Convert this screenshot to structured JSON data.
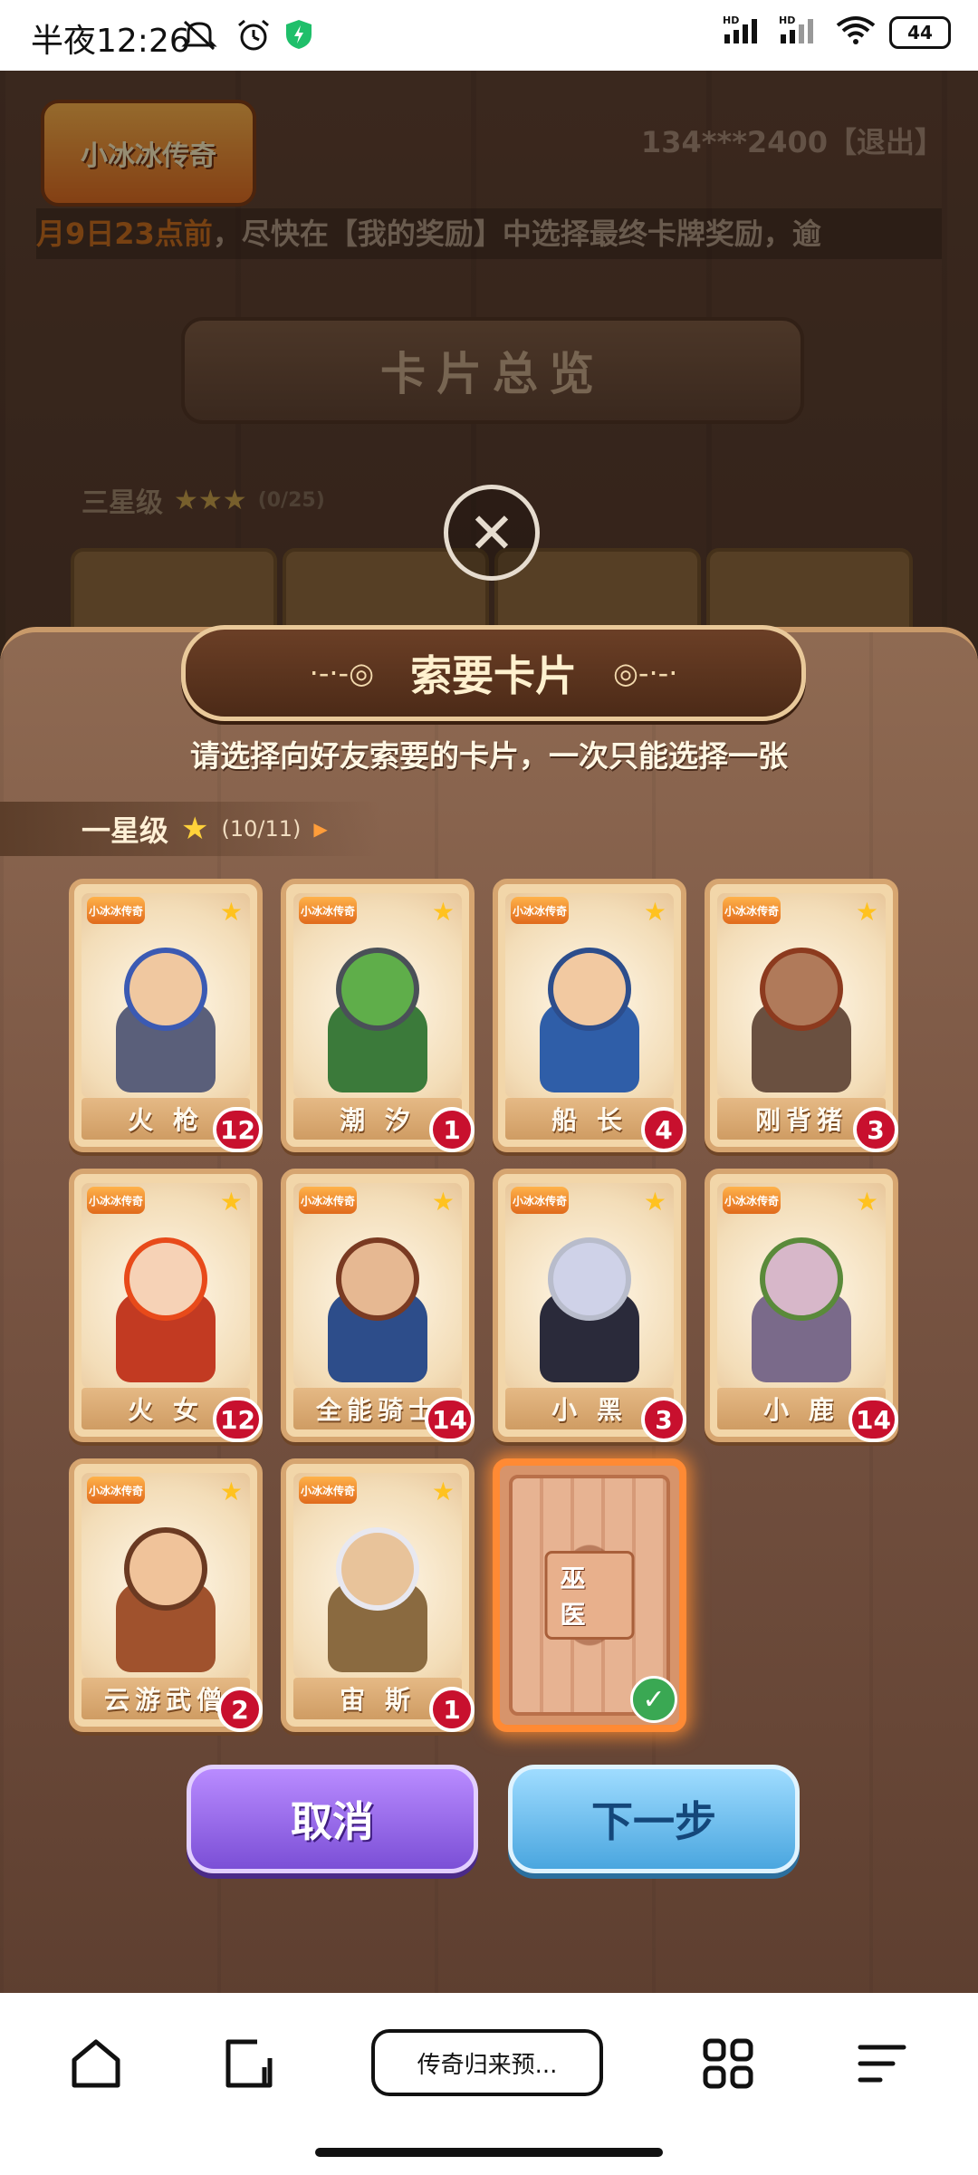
{
  "status_bar": {
    "time": "半夜12:26",
    "network": "HD",
    "wifi_label": "6",
    "battery": "44"
  },
  "game": {
    "logo_text": "小冰冰传奇",
    "account": "134***2400【退出】",
    "marquee_highlight": "月9日23点前",
    "marquee_text": "，尽快在【我的奖励】中选择最终卡牌奖励，逾",
    "banner_title": "卡片总览",
    "section_three_star": "三星级",
    "section_three_star_count": "(0/25)"
  },
  "modal": {
    "title": "索要卡片",
    "subtitle": "请选择向好友索要的卡片，一次只能选择一张",
    "tier_name": "一星级",
    "tier_count": "(10/11)",
    "cards": [
      {
        "name": "火 枪",
        "count": "12",
        "hair": "#3b5ab3",
        "skin": "#f0c8a0",
        "body": "#5a5f7a"
      },
      {
        "name": "潮 汐",
        "count": "1",
        "hair": "#4a5058",
        "skin": "#5fae4a",
        "body": "#3b7a3a"
      },
      {
        "name": "船 长",
        "count": "4",
        "hair": "#2c4d8c",
        "skin": "#f2c9a1",
        "body": "#2f5ea8"
      },
      {
        "name": "刚背猪",
        "count": "3",
        "hair": "#8c3a1e",
        "skin": "#b07a5a",
        "body": "#6a5040"
      },
      {
        "name": "火 女",
        "count": "12",
        "hair": "#e84a1a",
        "skin": "#f6d2b6",
        "body": "#c23a22"
      },
      {
        "name": "全能骑士",
        "count": "14",
        "hair": "#7a3a22",
        "skin": "#e6b892",
        "body": "#2d4d8a"
      },
      {
        "name": "小 黑",
        "count": "3",
        "hair": "#b8bccb",
        "skin": "#cfd2e8",
        "body": "#2a2a3a"
      },
      {
        "name": "小 鹿",
        "count": "14",
        "hair": "#5a8a3a",
        "skin": "#d7b7c9",
        "body": "#7a6a8a"
      },
      {
        "name": "云游武僧",
        "count": "2",
        "hair": "#6b3a22",
        "skin": "#f0c39a",
        "body": "#a0522d"
      },
      {
        "name": "宙 斯",
        "count": "1",
        "hair": "#e8e8f0",
        "skin": "#e8c39a",
        "body": "#8a6a40"
      }
    ],
    "selected_card": {
      "name": "巫 医"
    },
    "cancel_label": "取消",
    "next_label": "下一步"
  },
  "browser": {
    "tab_title": "传奇归来预..."
  }
}
